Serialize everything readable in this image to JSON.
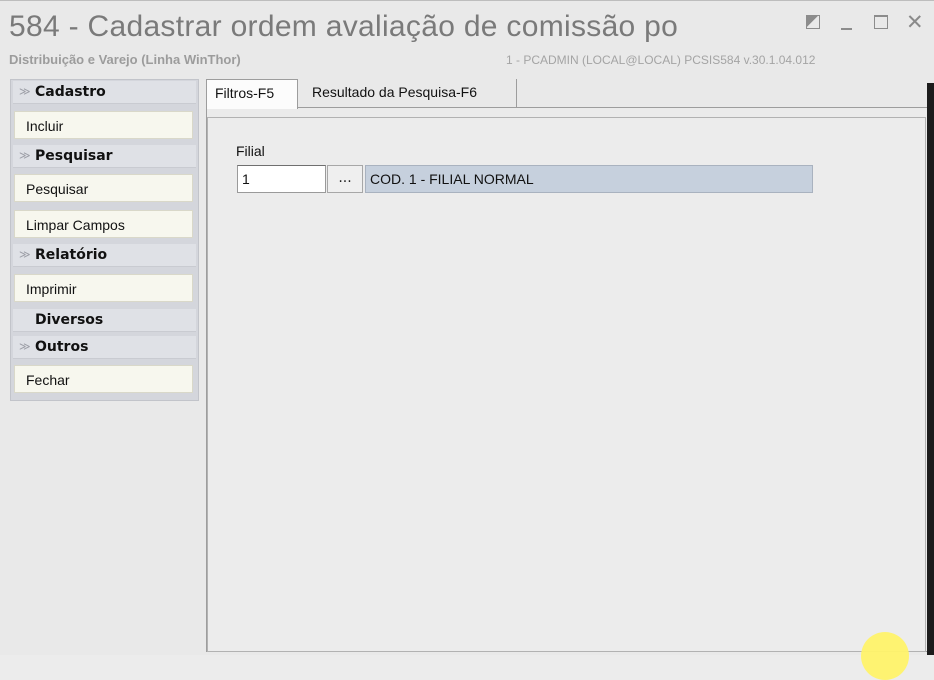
{
  "window": {
    "title": "584 - Cadastrar ordem avaliação de comissão po",
    "subtitle": "Distribuição e Varejo (Linha WinThor)",
    "user_info": "1 - PCADMIN (LOCAL@LOCAL)   PCSIS584  v.30.1.04.012",
    "controls": {
      "close": "✕"
    }
  },
  "sidebar": {
    "groups": [
      {
        "label": "Cadastro",
        "icon": "chevron-double-down-icon",
        "items": [
          {
            "label": "Incluir"
          }
        ]
      },
      {
        "label": "Pesquisar",
        "icon": "chevron-double-down-icon",
        "items": [
          {
            "label": "Pesquisar"
          },
          {
            "label": "Limpar Campos"
          }
        ]
      },
      {
        "label": "Relatório",
        "icon": "chevron-double-down-icon",
        "items": [
          {
            "label": "Imprimir"
          }
        ]
      },
      {
        "label": "Diversos",
        "items": []
      },
      {
        "label": "Outros",
        "icon": "chevron-double-down-icon",
        "items": [
          {
            "label": "Fechar"
          }
        ]
      }
    ],
    "chevron_glyph": "≫"
  },
  "tabs": [
    {
      "label": "Filtros-F5",
      "active": true
    },
    {
      "label": "Resultado da Pesquisa-F6",
      "active": false
    }
  ],
  "filters": {
    "filial_label": "Filial",
    "filial_value": "1",
    "lookup_button": "...",
    "filial_description": "COD. 1 - FILIAL NORMAL"
  },
  "colors": {
    "title_gray": "#7a7a7a",
    "sidebar_bg": "#d4d6dc",
    "item_bg": "#f7f7ee",
    "description_bg": "#c6d0dd",
    "cursor_highlight": "#fff36a"
  }
}
